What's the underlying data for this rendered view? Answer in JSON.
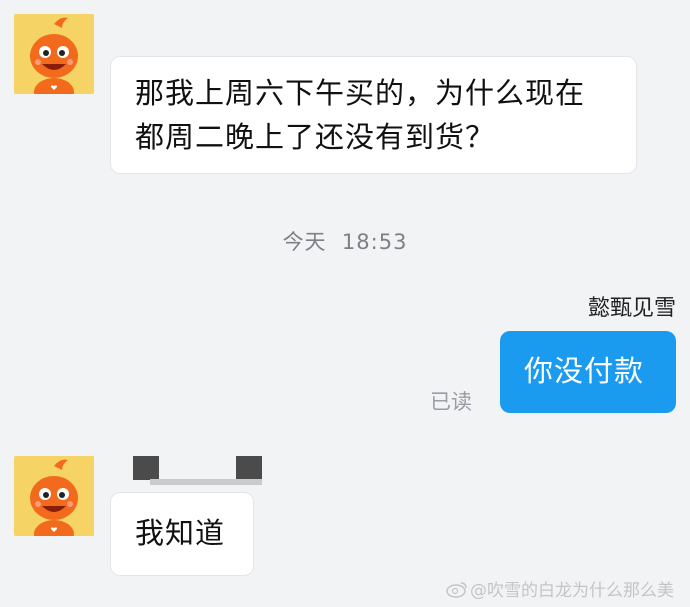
{
  "messages": [
    {
      "direction": "incoming",
      "lines": [
        "那我上周六下午买的，为什么现在",
        "都周二晚上了还没有到货？"
      ]
    },
    {
      "direction": "outgoing",
      "sender": "懿甄见雪",
      "text": "你没付款",
      "status": "已读"
    },
    {
      "direction": "incoming",
      "text": "我知道"
    }
  ],
  "timestamp": "今天  18:53",
  "watermark": "@吹雪的白龙为什么那么美",
  "avatar_icon": "orange-mascot-icon",
  "colors": {
    "background": "#f2f3f5",
    "incoming_bubble": "#ffffff",
    "outgoing_bubble": "#1a9bf0",
    "avatar_background": "#f6d365",
    "mascot": "#f26b1d"
  }
}
